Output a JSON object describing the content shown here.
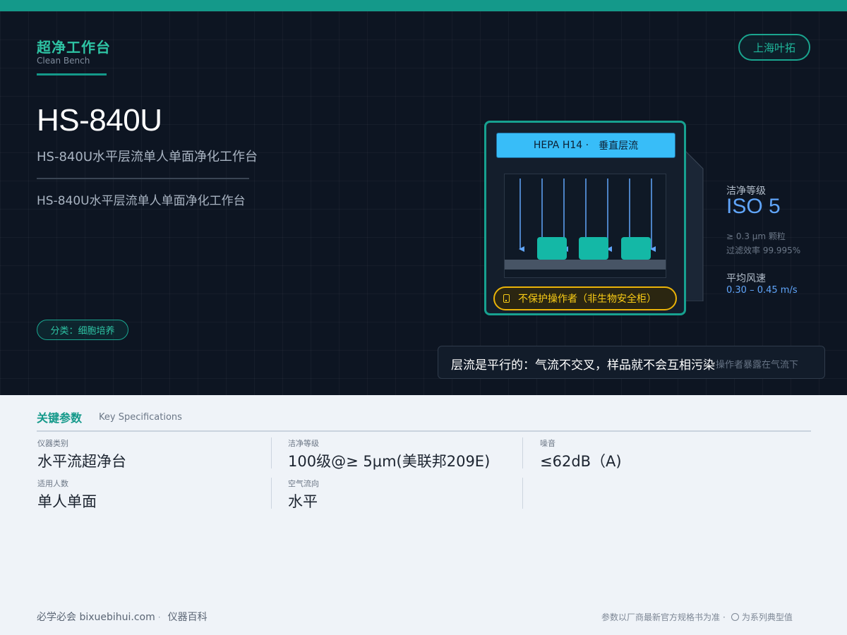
{
  "header": {
    "category_title": "超净工作台",
    "category_subtitle": "Clean Bench",
    "brand": "上海叶拓"
  },
  "product": {
    "model": "HS-840U",
    "description": "HS-840U水平层流单人单面净化工作台",
    "description_secondary": "HS-840U水平层流单人单面净化工作台",
    "category_tag": "分类：细胞培养"
  },
  "illustration": {
    "hepa_filter": "HEPA H14 ·",
    "flow_direction": "垂直层流",
    "warning": "不保护操作者（非生物安全柜）"
  },
  "metrics": {
    "cleanliness_label": "洁净等级",
    "cleanliness_value": "ISO 5",
    "particle_size": "≥ 0.3 μm 颗粒",
    "filter_efficiency": "过滤效率 99.995%",
    "airspeed_label": "平均风速",
    "airspeed_value": "0.30 – 0.45 m/s"
  },
  "callout": {
    "main_text": "层流是平行的：气流不交叉，样品就不会互相污染",
    "ghost_text": "操作者暴露在气流下"
  },
  "specs": {
    "title": "关键参数",
    "subtitle": "Key Specifications",
    "items": [
      {
        "label": "仪器类别",
        "value": "水平流超净台"
      },
      {
        "label": "洁净等级",
        "value": "100级@≥ 5μm(美联邦209E)"
      },
      {
        "label": "噪音",
        "value": "≤62dB（A)"
      },
      {
        "label": "适用人数",
        "value": "单人单面"
      },
      {
        "label": "空气流向",
        "value": "水平"
      }
    ]
  },
  "footer": {
    "site": "必学必会 bixuebihui.com",
    "section": "仪器百科",
    "note": "参数以厂商最新官方规格书为准",
    "note2": "为系列典型值"
  },
  "colors": {
    "accent": "#14998a",
    "hero_bg": "#0d1522",
    "filter": "#38bdf8",
    "airflow": "#60a5fa",
    "warning": "#facc15",
    "sample": "#14b8a6"
  }
}
